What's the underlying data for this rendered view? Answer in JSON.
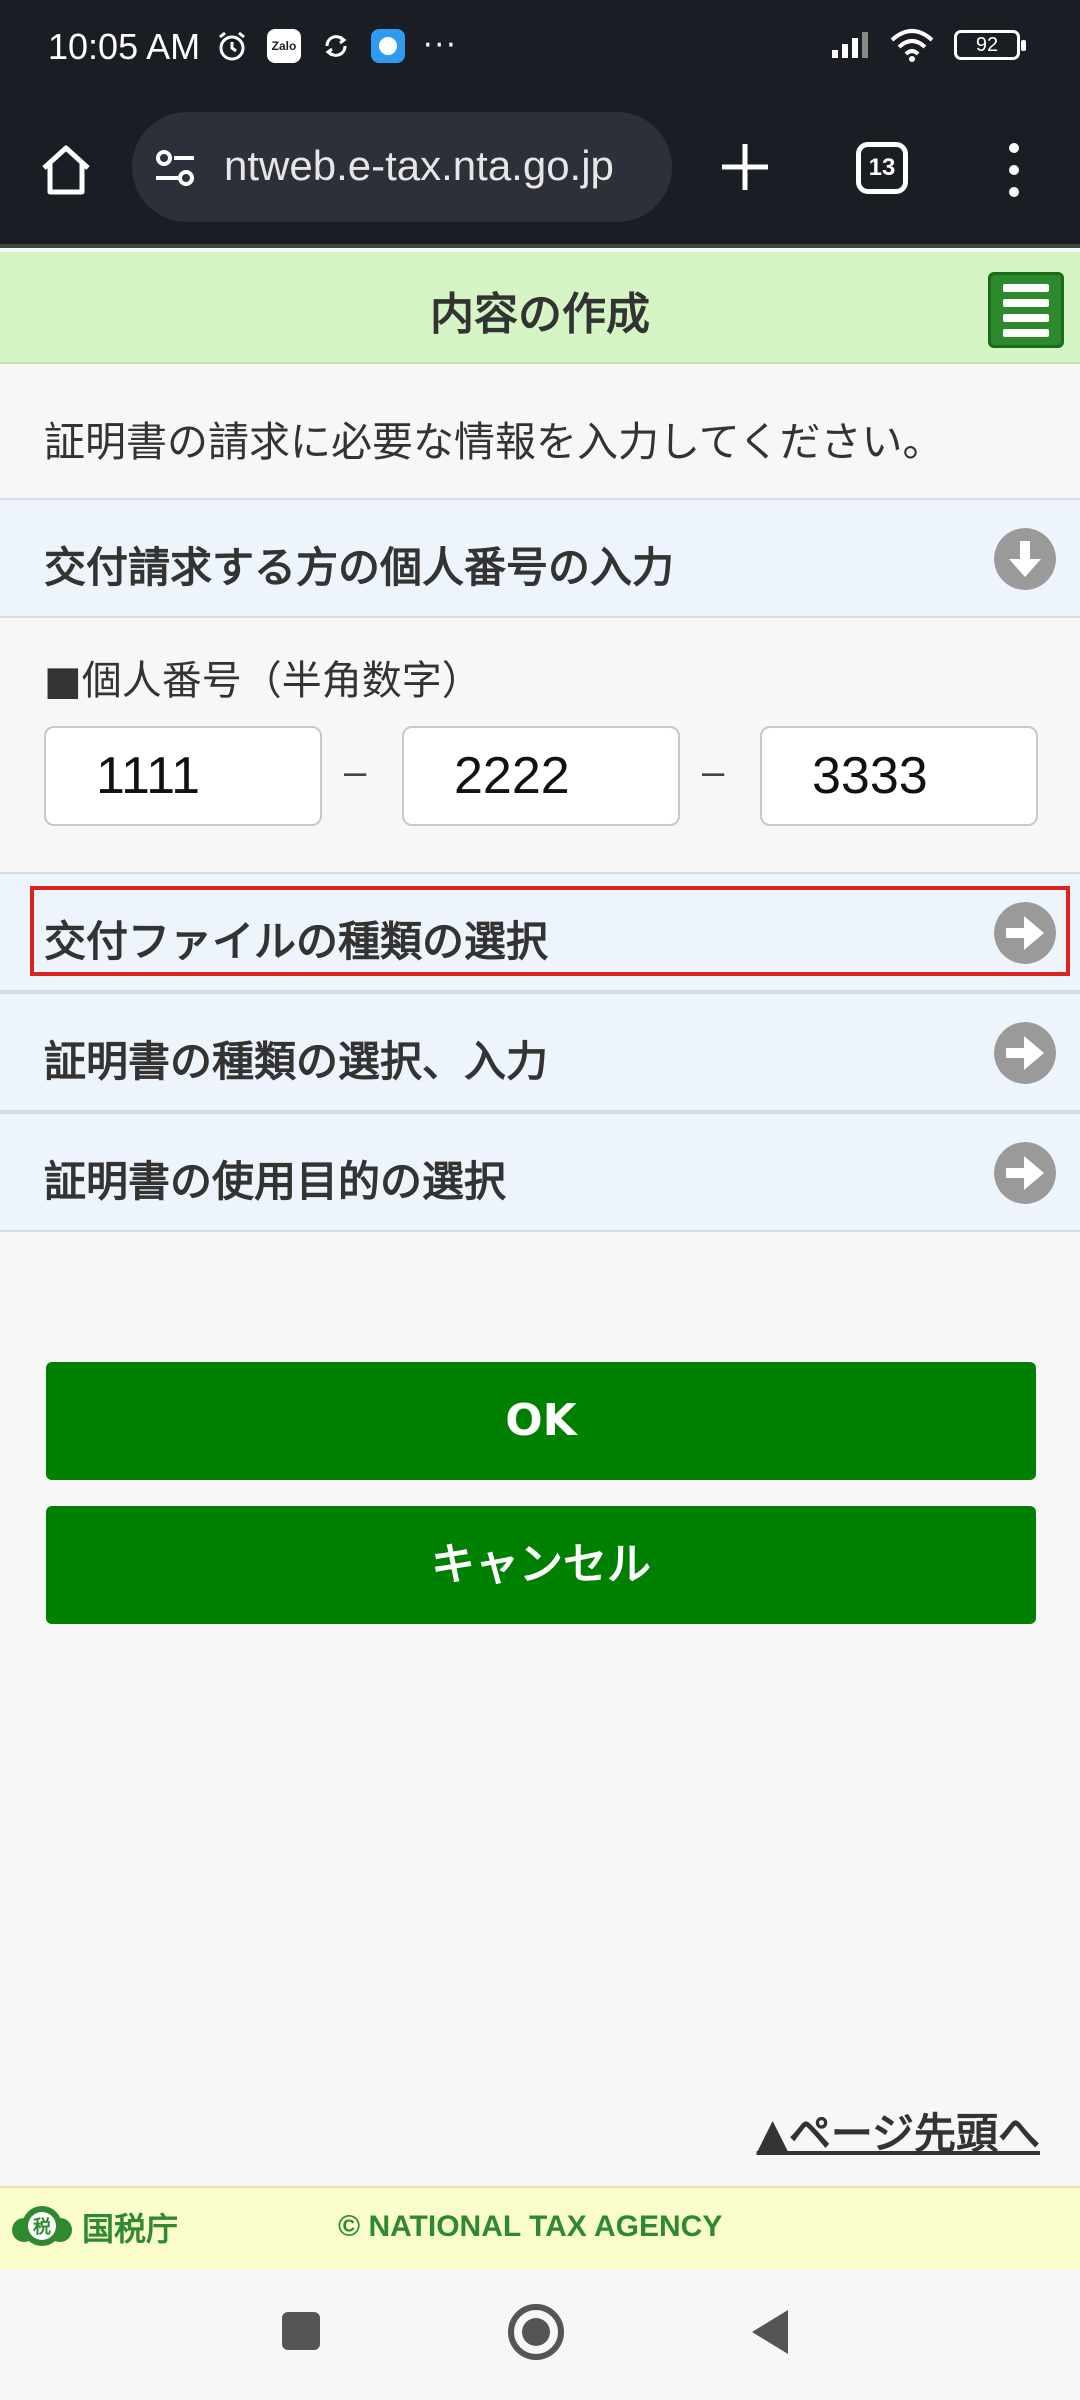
{
  "status_bar": {
    "time": "10:05 AM",
    "notif_zalo": "Zalo",
    "more": "···",
    "battery": "92"
  },
  "browser": {
    "url": "ntweb.e-tax.nta.go.jp",
    "tab_count": "13"
  },
  "header": {
    "title": "内容の作成"
  },
  "intro": {
    "text": "証明書の請求に必要な情報を入力してください。"
  },
  "sections": {
    "personal_number": {
      "label": "交付請求する方の個人番号の入力"
    },
    "file_type": {
      "label": "交付ファイルの種類の選択"
    },
    "cert_type": {
      "label": "証明書の種類の選択、入力"
    },
    "cert_purpose": {
      "label": "証明書の使用目的の選択"
    }
  },
  "number_form": {
    "label": "■個人番号（半角数字）",
    "part1": "1111",
    "part2": "2222",
    "part3": "3333",
    "separator": "–"
  },
  "buttons": {
    "ok": "OK",
    "cancel": "キャンセル"
  },
  "page_top_link": "▲ページ先頭へ",
  "footer": {
    "logo_text": "国税庁",
    "logo_mark": "税",
    "copyright": "© NATIONAL TAX AGENCY"
  },
  "colors": {
    "header_bg": "#d6f5c4",
    "button_green": "#008000",
    "highlight_red": "#dd2222",
    "footer_bg": "#fbfccb"
  }
}
